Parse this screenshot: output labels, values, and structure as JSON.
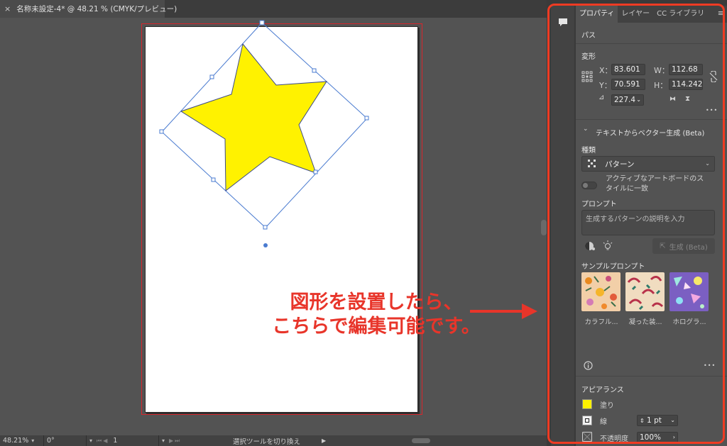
{
  "document": {
    "tab_title": "名称未設定-4* @ 48.21 % (CMYK/プレビュー)",
    "close_glyph": "×"
  },
  "annotation": {
    "line1": "図形を設置したら、",
    "line2": "こちらで編集可能です。",
    "color": "#e8352a"
  },
  "star": {
    "fill": "#fff200",
    "stroke": "#3b4a8a",
    "bbox_color": "#4a7bd0"
  },
  "statusbar": {
    "zoom": "48.21%",
    "rotation": "0°",
    "artboard_number": "1",
    "status_text": "選択ツールを切り換え"
  },
  "panel": {
    "tabs": [
      "プロパティ",
      "レイヤー",
      "CC ライブラリ"
    ],
    "menu_glyph": "≡",
    "object_type": "パス",
    "transform": {
      "title": "変形",
      "x_label": "X：",
      "x_value": "83.601",
      "y_label": "Y：",
      "y_value": "70.591",
      "w_label": "W：",
      "w_value": "112.68",
      "h_label": "H：",
      "h_value": "114.242",
      "angle_value": "227.4",
      "more_glyph": "•••"
    },
    "text_to_vector": {
      "title": "テキストからベクター生成 (Beta)",
      "type_label": "種類",
      "type_value": "パターン",
      "toggle_label_1": "アクティブなアートボードのス",
      "toggle_label_2": "タイルに一致",
      "prompt_label": "プロンプト",
      "prompt_placeholder": "生成するパターンの説明を入力",
      "generate_label": "生成 (Beta)",
      "samples_label": "サンプルプロンプト",
      "samples": [
        {
          "caption": "カラフル..."
        },
        {
          "caption": "凝った装..."
        },
        {
          "caption": "ホログラ..."
        }
      ],
      "more_glyph": "•••"
    },
    "appearance": {
      "title": "アピアランス",
      "fill_label": "塗り",
      "fill_color": "#fff200",
      "stroke_label": "線",
      "stroke_weight": "1 pt",
      "opacity_label": "不透明度",
      "opacity_value": "100%"
    }
  },
  "highlight_color": "#ef3b23"
}
